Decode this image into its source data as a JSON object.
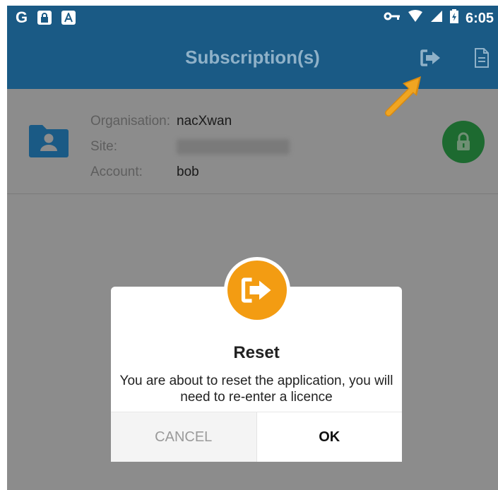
{
  "status_bar": {
    "left_icons": [
      "g-logo-icon",
      "lock-notification-icon",
      "font-notification-icon"
    ],
    "g_text": "G",
    "right_icons": [
      "vpn-key-icon",
      "wifi-icon",
      "cell-signal-icon",
      "battery-icon"
    ],
    "time": "6:05"
  },
  "app_bar": {
    "title": "Subscription(s)",
    "actions": [
      "logout-icon",
      "document-icon"
    ]
  },
  "subscription": {
    "organisation_label": "Organisation:",
    "organisation_value": "nacXwan",
    "site_label": "Site:",
    "account_label": "Account:",
    "account_value": "bob",
    "status": "locked"
  },
  "dialog": {
    "title": "Reset",
    "message": "You are about to reset the application, you will need to re-enter a licence",
    "cancel_label": "CANCEL",
    "ok_label": "OK"
  },
  "colors": {
    "primary": "#1a5a85",
    "accent": "#f39c12",
    "lock_green": "#1d6a30",
    "overlay": "#8c8c8c"
  }
}
